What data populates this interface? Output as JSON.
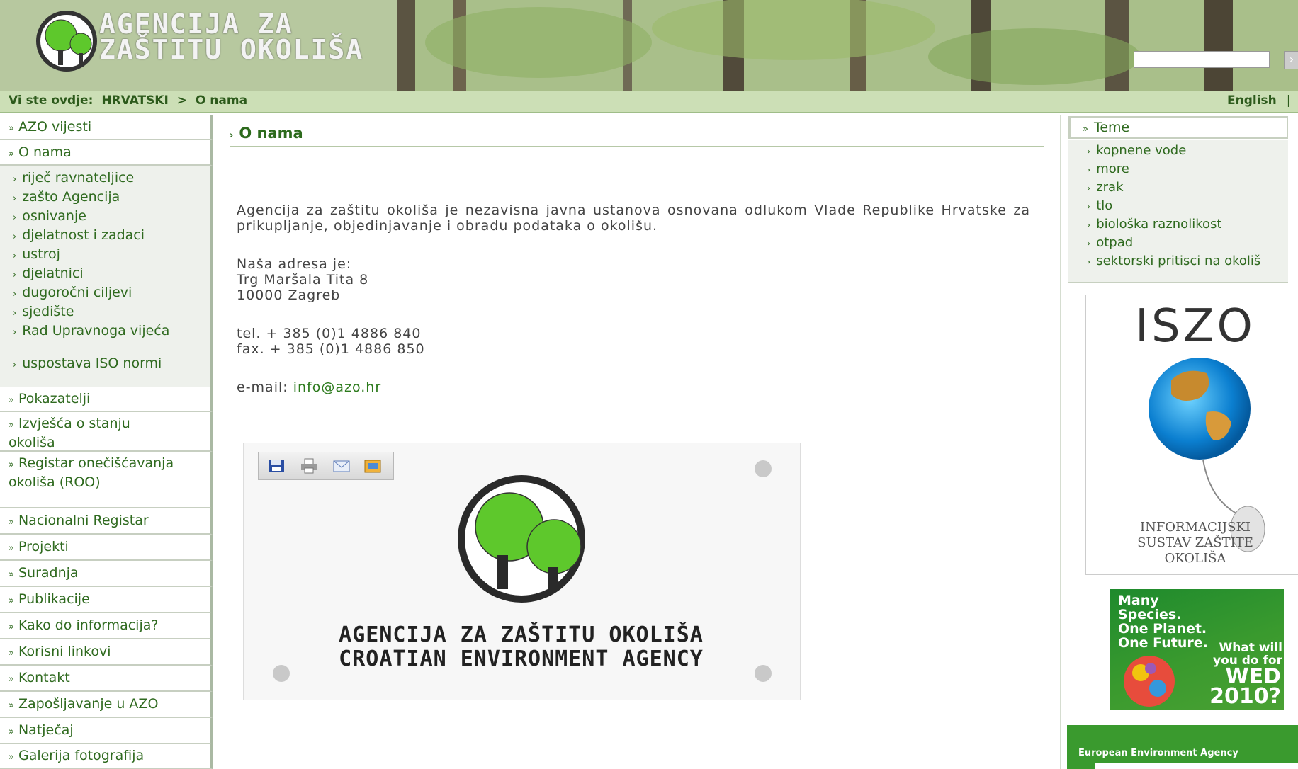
{
  "header": {
    "logo_text_line1": "AGENCIJA ZA",
    "logo_text_line2": "ZAŠTITU OKOLIŠA",
    "search": {
      "placeholder": "",
      "button_label": "›"
    }
  },
  "breadcrumb": {
    "prefix": "Vi ste ovdje:",
    "home": "HRVATSKI",
    "separator": ">",
    "current": "O nama",
    "language_link": "English",
    "language_separator": "|"
  },
  "left_nav": {
    "marker": "»",
    "sub_marker": "›",
    "items_top": [
      {
        "label": "AZO vijesti"
      },
      {
        "label": "O nama"
      }
    ],
    "sub_items": [
      {
        "label": "riječ ravnateljice"
      },
      {
        "label": "zašto Agencija"
      },
      {
        "label": "osnivanje"
      },
      {
        "label": "djelatnost i zadaci"
      },
      {
        "label": "ustroj"
      },
      {
        "label": "djelatnici"
      },
      {
        "label": "dugoročni ciljevi"
      },
      {
        "label": "sjedište"
      },
      {
        "label": "Rad Upravnoga vijeća"
      },
      {
        "label": "uspostava ISO normi"
      }
    ],
    "items_bottom": [
      {
        "label": "Pokazatelji"
      },
      {
        "label": "Izvješća o stanju okoliša"
      },
      {
        "label": "Registar onečišćavanja okoliša (ROO)"
      },
      {
        "label": "Nacionalni Registar"
      },
      {
        "label": "Projekti"
      },
      {
        "label": "Suradnja"
      },
      {
        "label": "Publikacije"
      },
      {
        "label": "Kako do informacija?"
      },
      {
        "label": "Korisni linkovi"
      },
      {
        "label": "Kontakt"
      },
      {
        "label": "Zapošljavanje u AZO"
      },
      {
        "label": "Natječaj"
      },
      {
        "label": "Galerija fotografija"
      }
    ]
  },
  "main": {
    "heading_marker": "›",
    "heading": "O nama",
    "intro": "Agencija za zaštitu okoliša je nezavisna javna ustanova osnovana odlukom Vlade Republike Hrvatske za prikupljanje, objedinjavanje i obradu podataka o okolišu.",
    "address_label": "Naša adresa je:",
    "address_line1": "Trg Maršala Tita 8",
    "address_line2": "10000 Zagreb",
    "tel": "tel. + 385 (0)1 4886 840",
    "fax": "fax. + 385 (0)1 4886 850",
    "email_label": "e-mail:",
    "email": "info@azo.hr",
    "logo_caption_line1": "AGENCIJA ZA ZAŠTITU OKOLIŠA",
    "logo_caption_line2": "CROATIAN ENVIRONMENT AGENCY"
  },
  "right": {
    "teme_marker": "»",
    "teme_title": "Teme",
    "teme_items": [
      {
        "label": "kopnene vode"
      },
      {
        "label": "more"
      },
      {
        "label": "zrak"
      },
      {
        "label": "tlo"
      },
      {
        "label": "biološka raznolikost"
      },
      {
        "label": "otpad"
      },
      {
        "label": "sektorski pritisci na okoliš"
      }
    ],
    "iszo_title": "ISZO",
    "iszo_caption_line1": "INFORMACIJSKI",
    "iszo_caption_line2": "SUSTAV ZAŠTITE",
    "iszo_caption_line3": "OKOLIŠA",
    "wed_line1": "Many Species.",
    "wed_line2": "One Planet.",
    "wed_line3": "One Future.",
    "wed_q1": "What will",
    "wed_q2": "you do for",
    "wed_big1": "WED",
    "wed_big2": "2010?",
    "eea_text": "European Environment Agency"
  },
  "colors": {
    "nav_green": "#2f6a1f",
    "crumb_bg": "#ccdfb6",
    "logo_green": "#5ec82c"
  }
}
